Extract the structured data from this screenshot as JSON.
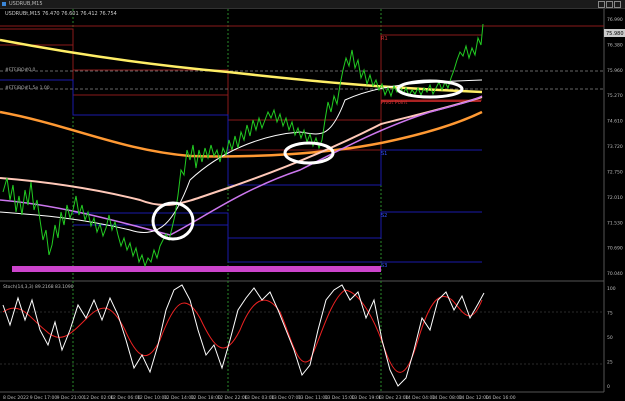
{
  "window": {
    "title": "USDRUB,M15"
  },
  "header": {
    "quote": "USDRUBt,M15  76.470 76.601 76.412 76.754"
  },
  "annotations": {
    "fibo_label_1": "#FTFIBO#0.0",
    "fibo_label_2": "#FTFIBO#1.5e 1.00",
    "pivot_label": "Pivot Point"
  },
  "levels": {
    "r1": "R1",
    "s1": "S1",
    "s2": "S2",
    "s3": "S3"
  },
  "price_axis": [
    "76.990",
    "76.380",
    "75.960",
    "75.270",
    "74.610",
    "73.720",
    "72.750",
    "72.010",
    "71.530",
    "70.690",
    "70.040"
  ],
  "current_price": "75.980",
  "oscillator": {
    "label": "Stoch(14,3,3) 89.2168 83.1090",
    "axis": [
      "100",
      "75",
      "50",
      "25",
      "0"
    ]
  },
  "time_axis": [
    "8 Dec 2022",
    "9 Dec 17:00",
    "9 Dec 21:00",
    "12 Dec 02:00",
    "12 Dec 06:00",
    "12 Dec 10:00",
    "12 Dec 14:00",
    "12 Dec 18:00",
    "12 Dec 22:00",
    "13 Dec 03:00",
    "13 Dec 07:00",
    "13 Dec 11:00",
    "13 Dec 15:00",
    "13 Dec 19:00",
    "13 Dec 23:00",
    "14 Dec 04:00",
    "14 Dec 08:00",
    "14 Dec 12:00",
    "14 Dec 16:00"
  ],
  "colors": {
    "background": "#000000",
    "candles": "#22cc22",
    "ma_yellow": "#ffee66",
    "ma_orange": "#ff9933",
    "ma_pink": "#ffc8b8",
    "ma_violet": "#cc77ee",
    "ma_white": "#ffffff",
    "stoch_main": "#ffffff",
    "stoch_signal": "#ee2222",
    "magenta_bar": "#cc44cc",
    "highlight_ellipse": "#ffffff"
  }
}
